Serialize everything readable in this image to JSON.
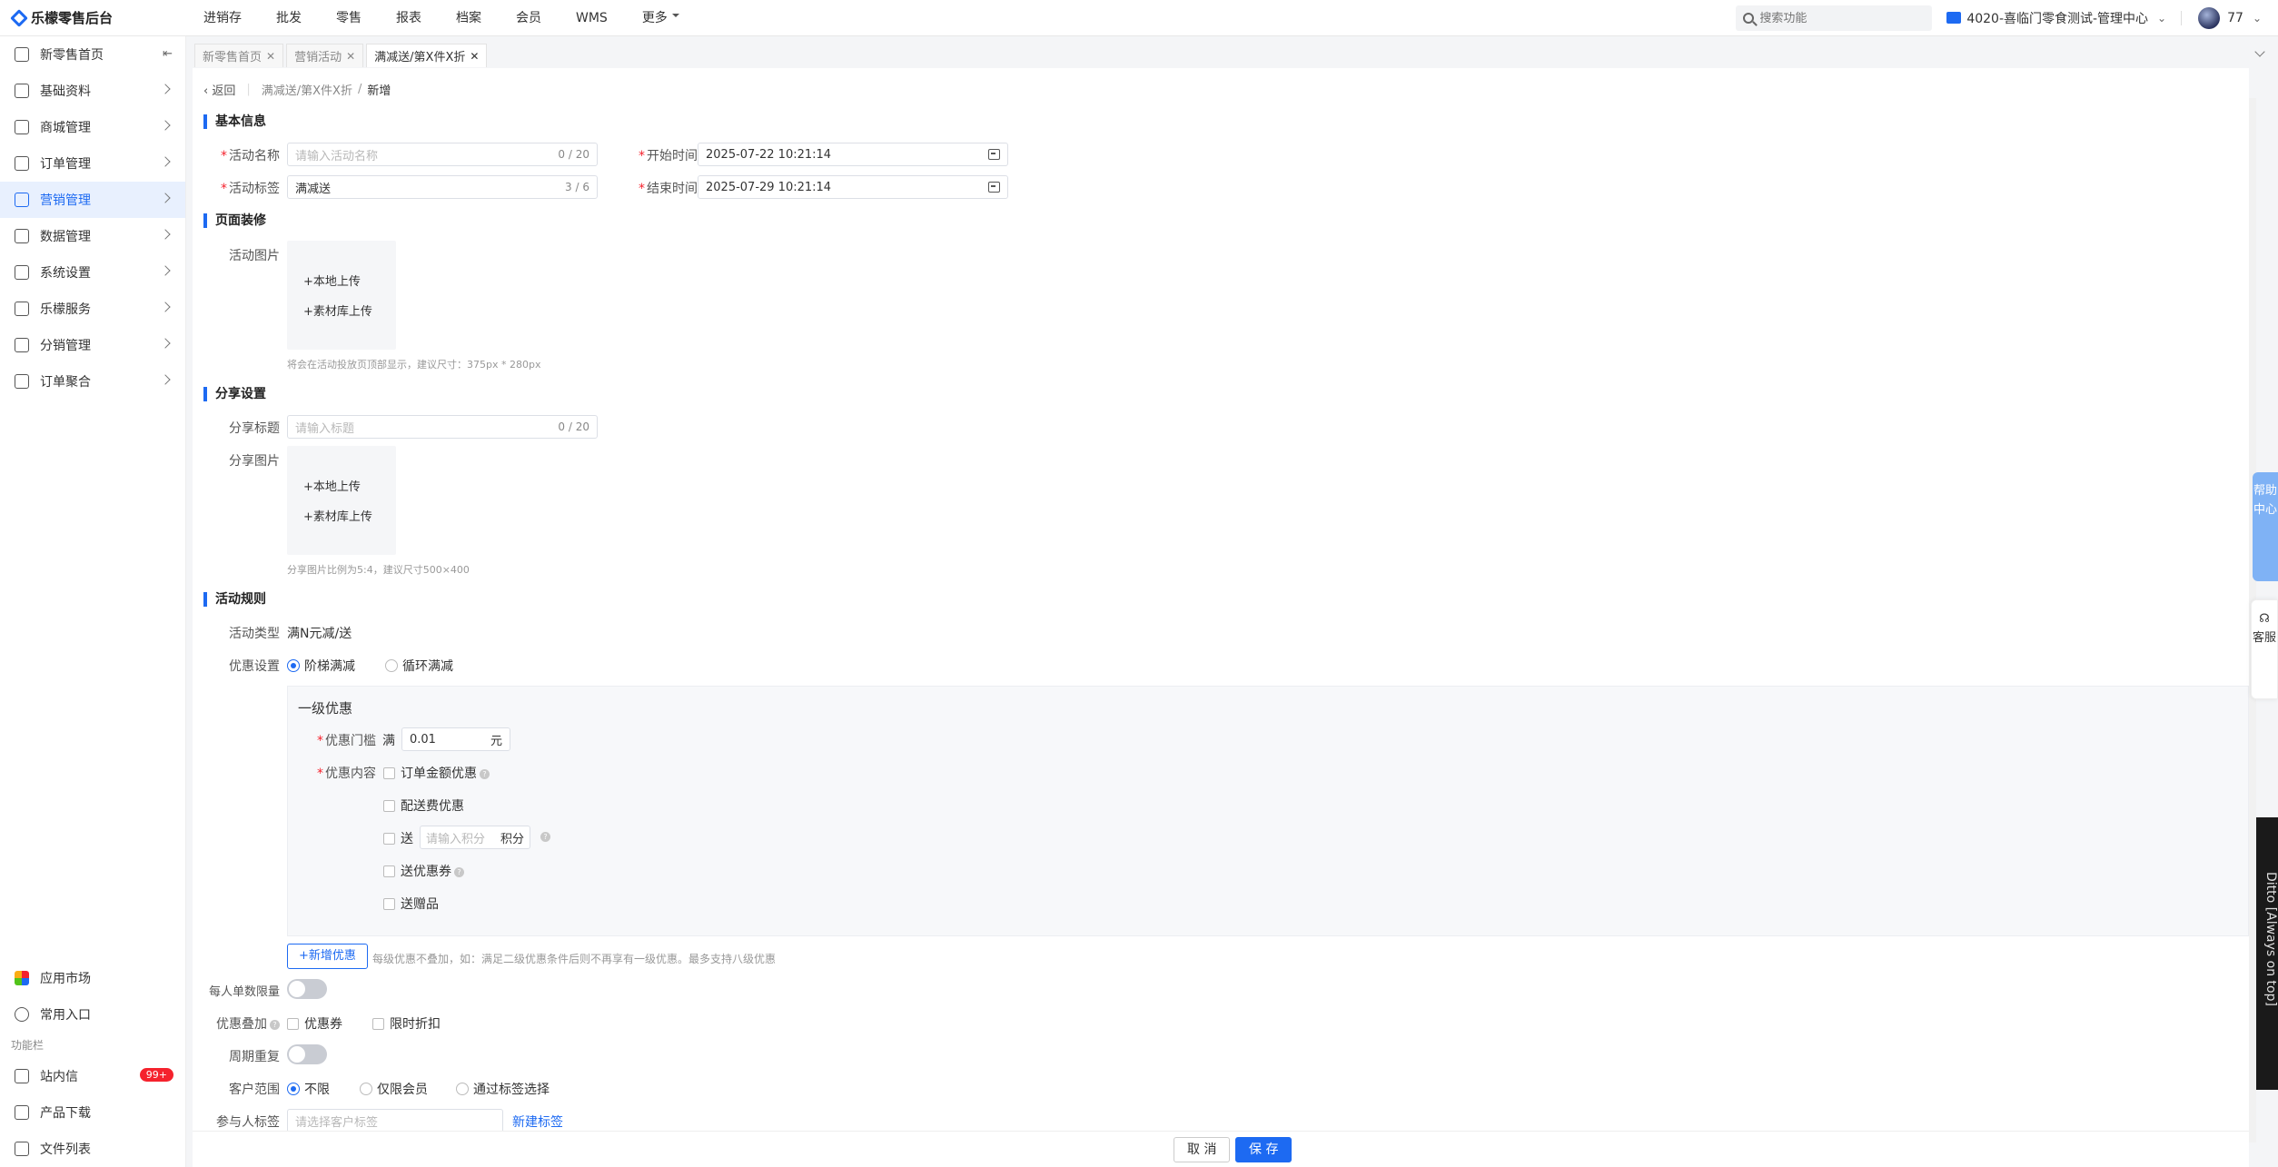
{
  "app": {
    "title": "乐檬零售后台",
    "accent": "#1d6af2"
  },
  "topnav": {
    "items": [
      "进销存",
      "批发",
      "零售",
      "报表",
      "档案",
      "会员",
      "WMS",
      "更多"
    ]
  },
  "search": {
    "placeholder": "搜索功能"
  },
  "store": {
    "name": "4020-喜临门零食测试-管理中心"
  },
  "user": {
    "name": "77"
  },
  "sidebar": {
    "items": [
      {
        "label": "新零售首页",
        "icon": "home-icon"
      },
      {
        "label": "基础资料",
        "icon": "grid-icon"
      },
      {
        "label": "商城管理",
        "icon": "shop-icon"
      },
      {
        "label": "订单管理",
        "icon": "order-icon"
      },
      {
        "label": "营销管理",
        "icon": "marketing-icon",
        "active": true
      },
      {
        "label": "数据管理",
        "icon": "chart-icon"
      },
      {
        "label": "系统设置",
        "icon": "settings-icon"
      },
      {
        "label": "乐檬服务",
        "icon": "service-icon"
      },
      {
        "label": "分销管理",
        "icon": "distribution-icon"
      },
      {
        "label": "订单聚合",
        "icon": "aggregate-icon"
      }
    ],
    "apps_market": "应用市场",
    "common_entry": "常用入口",
    "section_label": "功能栏",
    "inbox": "站内信",
    "inbox_badge": "99+",
    "downloads": "产品下载",
    "files": "文件列表"
  },
  "tabs": [
    {
      "label": "新零售首页"
    },
    {
      "label": "营销活动"
    },
    {
      "label": "满减送/第X件X折",
      "active": true
    }
  ],
  "breadcrumb": {
    "back": "返回",
    "parent": "满减送/第X件X折",
    "current": "新增"
  },
  "basic": {
    "title": "基本信息",
    "name_label": "活动名称",
    "name_placeholder": "请输入活动名称",
    "name_count": "0 / 20",
    "tag_label": "活动标签",
    "tag_value": "满减送",
    "tag_count": "3 / 6",
    "start_label": "开始时间",
    "start_value": "2025-07-22 10:21:14",
    "end_label": "结束时间",
    "end_value": "2025-07-29 10:21:14"
  },
  "decor": {
    "title": "页面装修",
    "image_label": "活动图片",
    "upload_local": "本地上传",
    "upload_library": "素材库上传",
    "hint": "将会在活动投放页顶部显示，建议尺寸：375px * 280px"
  },
  "share": {
    "title": "分享设置",
    "title_label": "分享标题",
    "title_placeholder": "请输入标题",
    "title_count": "0 / 20",
    "image_label": "分享图片",
    "upload_local": "本地上传",
    "upload_library": "素材库上传",
    "hint": "分享图片比例为5:4，建议尺寸500×400"
  },
  "rules": {
    "title": "活动规则",
    "type_label": "活动类型",
    "type_value": "满N元减/送",
    "discount_label": "优惠设置",
    "option_tiered": "阶梯满减",
    "option_loop": "循环满减",
    "tier_title": "一级优惠",
    "threshold_label": "优惠门槛",
    "threshold_prefix": "满",
    "threshold_value": "0.01",
    "threshold_unit": "元",
    "content_label": "优惠内容",
    "opt_order_amount": "订单金额优惠",
    "opt_delivery": "配送费优惠",
    "opt_send": "送",
    "points_placeholder": "请输入积分",
    "points_unit": "积分",
    "opt_coupon": "送优惠券",
    "opt_gift": "送赠品",
    "add_tier": "+新增优惠",
    "add_tier_hint": "每级优惠不叠加，如：满足二级优惠条件后则不再享有一级优惠。最多支持八级优惠",
    "limit_label": "每人单数限量",
    "stack_label": "优惠叠加",
    "stack_coupon": "优惠券",
    "stack_flash": "限时折扣",
    "repeat_label": "周期重复",
    "scope_label": "客户范围",
    "scope_all": "不限",
    "scope_member": "仅限会员",
    "scope_tag": "通过标签选择",
    "tag_label": "参与人标签",
    "tag_placeholder": "请选择客户标签",
    "new_tag": "新建标签"
  },
  "footer": {
    "cancel": "取 消",
    "save": "保 存"
  },
  "widgets": {
    "help": "帮助中心",
    "service": "客服",
    "ditto": "Ditto [Always on top]"
  }
}
